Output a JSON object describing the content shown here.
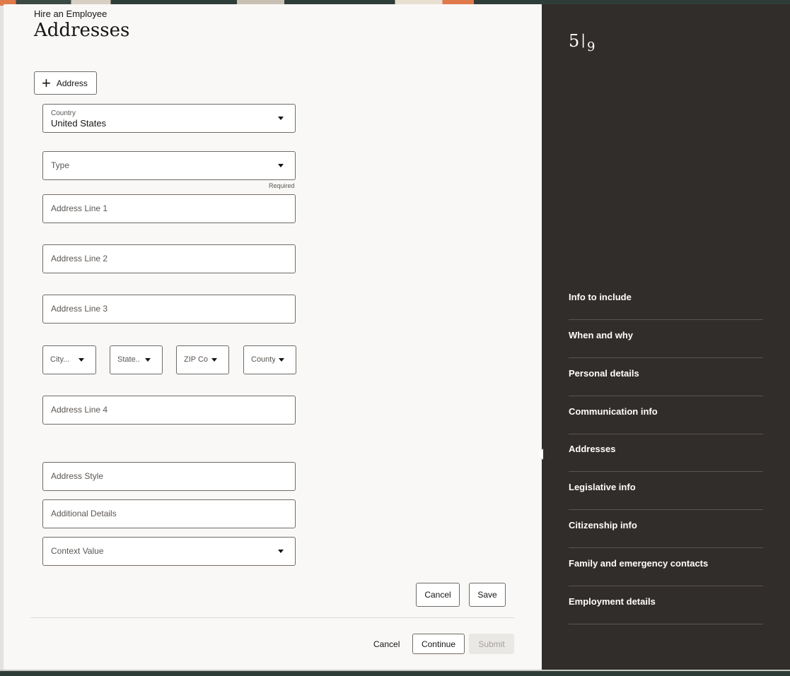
{
  "header": {
    "eyebrow": "Hire an Employee",
    "title": "Addresses"
  },
  "add_address_button": {
    "label": "Address",
    "icon": "plus-icon"
  },
  "form": {
    "country": {
      "label": "Country",
      "value": "United States"
    },
    "type": {
      "placeholder": "Type",
      "note": "Required"
    },
    "address_line_1": {
      "placeholder": "Address Line 1"
    },
    "address_line_2": {
      "placeholder": "Address Line 2"
    },
    "address_line_3": {
      "placeholder": "Address Line 3"
    },
    "city": {
      "placeholder": "City..."
    },
    "state": {
      "placeholder": "State.."
    },
    "zip": {
      "placeholder": "ZIP Co"
    },
    "county": {
      "placeholder": "County"
    },
    "address_line_4": {
      "placeholder": "Address Line 4"
    },
    "address_style": {
      "placeholder": "Address Style"
    },
    "additional_details": {
      "placeholder": "Additional Details"
    },
    "context_value": {
      "placeholder": "Context Value"
    }
  },
  "form_actions": {
    "cancel": "Cancel",
    "save": "Save"
  },
  "footer_actions": {
    "cancel": "Cancel",
    "continue": "Continue",
    "submit": "Submit"
  },
  "side_panel": {
    "current_step": "5",
    "total_steps": "9",
    "active_item": "Addresses",
    "items": [
      {
        "label": "Info to include"
      },
      {
        "label": "When and why"
      },
      {
        "label": "Personal details"
      },
      {
        "label": "Communication info"
      },
      {
        "label": "Addresses"
      },
      {
        "label": "Legislative info"
      },
      {
        "label": "Citizenship info"
      },
      {
        "label": "Family and emergency contacts"
      },
      {
        "label": "Employment details"
      }
    ]
  },
  "colors": {
    "side_panel_bg": "#312d2a",
    "page_bg": "#f9f8f6",
    "border": "#6f6b68"
  }
}
